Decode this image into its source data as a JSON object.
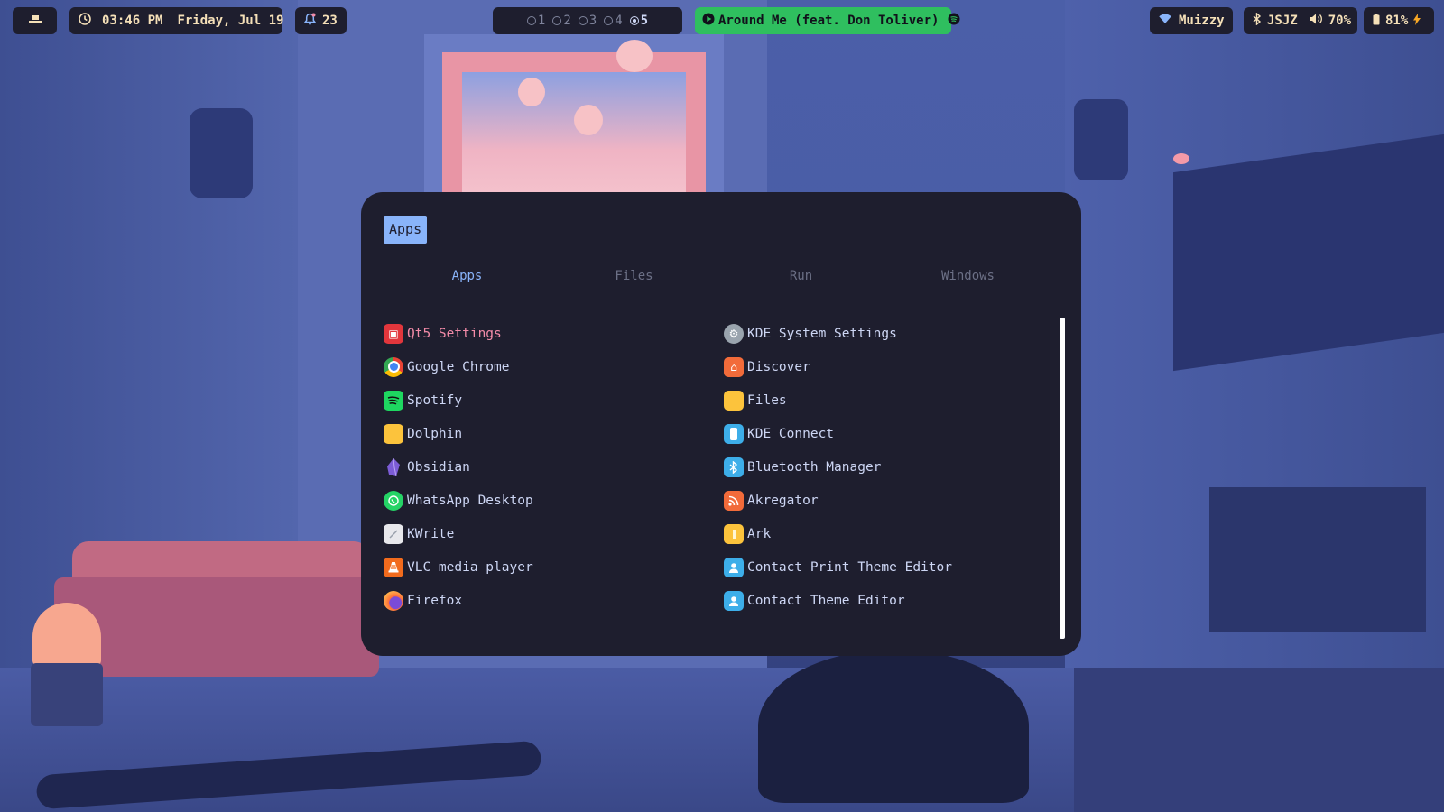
{
  "colors": {
    "bar_bg": "#1e1e2e",
    "bar_text": "#f5e0b8",
    "accent": "#89b4fa",
    "selected": "#f38ba8",
    "media_bg": "#2fbf5f",
    "launcher_bg": "#1e1e2e"
  },
  "topbar": {
    "launcher_icon": "menu-icon",
    "clock": {
      "icon": "clock-icon",
      "time": "03:46 PM",
      "date": "Friday, Jul 19"
    },
    "notifications": {
      "icon": "bell-icon",
      "count": "23"
    },
    "workspaces": [
      {
        "label": "1",
        "active": false
      },
      {
        "label": "2",
        "active": false
      },
      {
        "label": "3",
        "active": false
      },
      {
        "label": "4",
        "active": false
      },
      {
        "label": "5",
        "active": true
      }
    ],
    "media": {
      "icon": "play-icon",
      "title": "Around Me (feat. Don Toliver)",
      "app_icon": "spotify-icon"
    },
    "wifi": {
      "icon": "wifi-icon",
      "ssid": "Muizzy"
    },
    "bluetooth": {
      "icon": "bluetooth-icon",
      "device": "JSJZ"
    },
    "volume": {
      "icon": "volume-icon",
      "level": "70%"
    },
    "battery": {
      "icon": "battery-icon",
      "level": "81%",
      "charging_icon": "bolt-icon"
    }
  },
  "launcher": {
    "prompt": "Apps",
    "tabs": [
      "Apps",
      "Files",
      "Run",
      "Windows"
    ],
    "active_tab": "Apps",
    "apps": [
      {
        "label": "Qt5 Settings",
        "icon": "qt5-settings-icon",
        "selected": true
      },
      {
        "label": "KDE System Settings",
        "icon": "kde-settings-icon"
      },
      {
        "label": "Google Chrome",
        "icon": "chrome-icon"
      },
      {
        "label": "Discover",
        "icon": "discover-icon"
      },
      {
        "label": "Spotify",
        "icon": "spotify-icon"
      },
      {
        "label": "Files",
        "icon": "folder-icon"
      },
      {
        "label": "Dolphin",
        "icon": "dolphin-folder-icon"
      },
      {
        "label": "KDE Connect",
        "icon": "kde-connect-icon"
      },
      {
        "label": "Obsidian",
        "icon": "obsidian-icon"
      },
      {
        "label": "Bluetooth Manager",
        "icon": "bluetooth-icon"
      },
      {
        "label": "WhatsApp Desktop",
        "icon": "whatsapp-icon"
      },
      {
        "label": "Akregator",
        "icon": "rss-icon"
      },
      {
        "label": "KWrite",
        "icon": "kwrite-icon"
      },
      {
        "label": "Ark",
        "icon": "archive-icon"
      },
      {
        "label": "VLC media player",
        "icon": "vlc-icon"
      },
      {
        "label": "Contact Print Theme Editor",
        "icon": "contact-icon"
      },
      {
        "label": "Firefox",
        "icon": "firefox-icon"
      },
      {
        "label": "Contact Theme Editor",
        "icon": "contact-icon"
      }
    ]
  }
}
